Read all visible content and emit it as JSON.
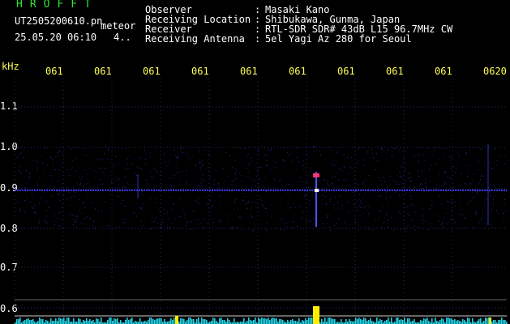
{
  "header": {
    "station_name": "HROFFT",
    "filename": "UT2505200610.pn",
    "meteor_label": "meteor",
    "datetime": "25.05.20 06:10",
    "count": "4..",
    "info": [
      {
        "label": "Observer",
        "value": "Masaki Kano"
      },
      {
        "label": "Receiving Location",
        "value": "Shibukawa, Gunma, Japan"
      },
      {
        "label": "Receiver",
        "value": "RTL-SDR SDR# 43dB L15 96.7MHz CW"
      },
      {
        "label": "Receiving Antenna",
        "value": "5el Yagi Az 280 for Seoul"
      }
    ]
  },
  "axis": {
    "unit": "kHz",
    "time_ticks": [
      "061",
      "061",
      "061",
      "061",
      "061",
      "061",
      "061",
      "061",
      "061",
      "0620"
    ],
    "freq_ticks": [
      "1.1",
      "1.0",
      "0.9",
      "0.8",
      "0.7",
      "0.6"
    ]
  },
  "colors": {
    "grid": "#2a2a6a",
    "baseline": "#3a3aff",
    "meteor": "#ff3377",
    "hist": "#22d3e6",
    "peak": "#ffee00"
  }
}
